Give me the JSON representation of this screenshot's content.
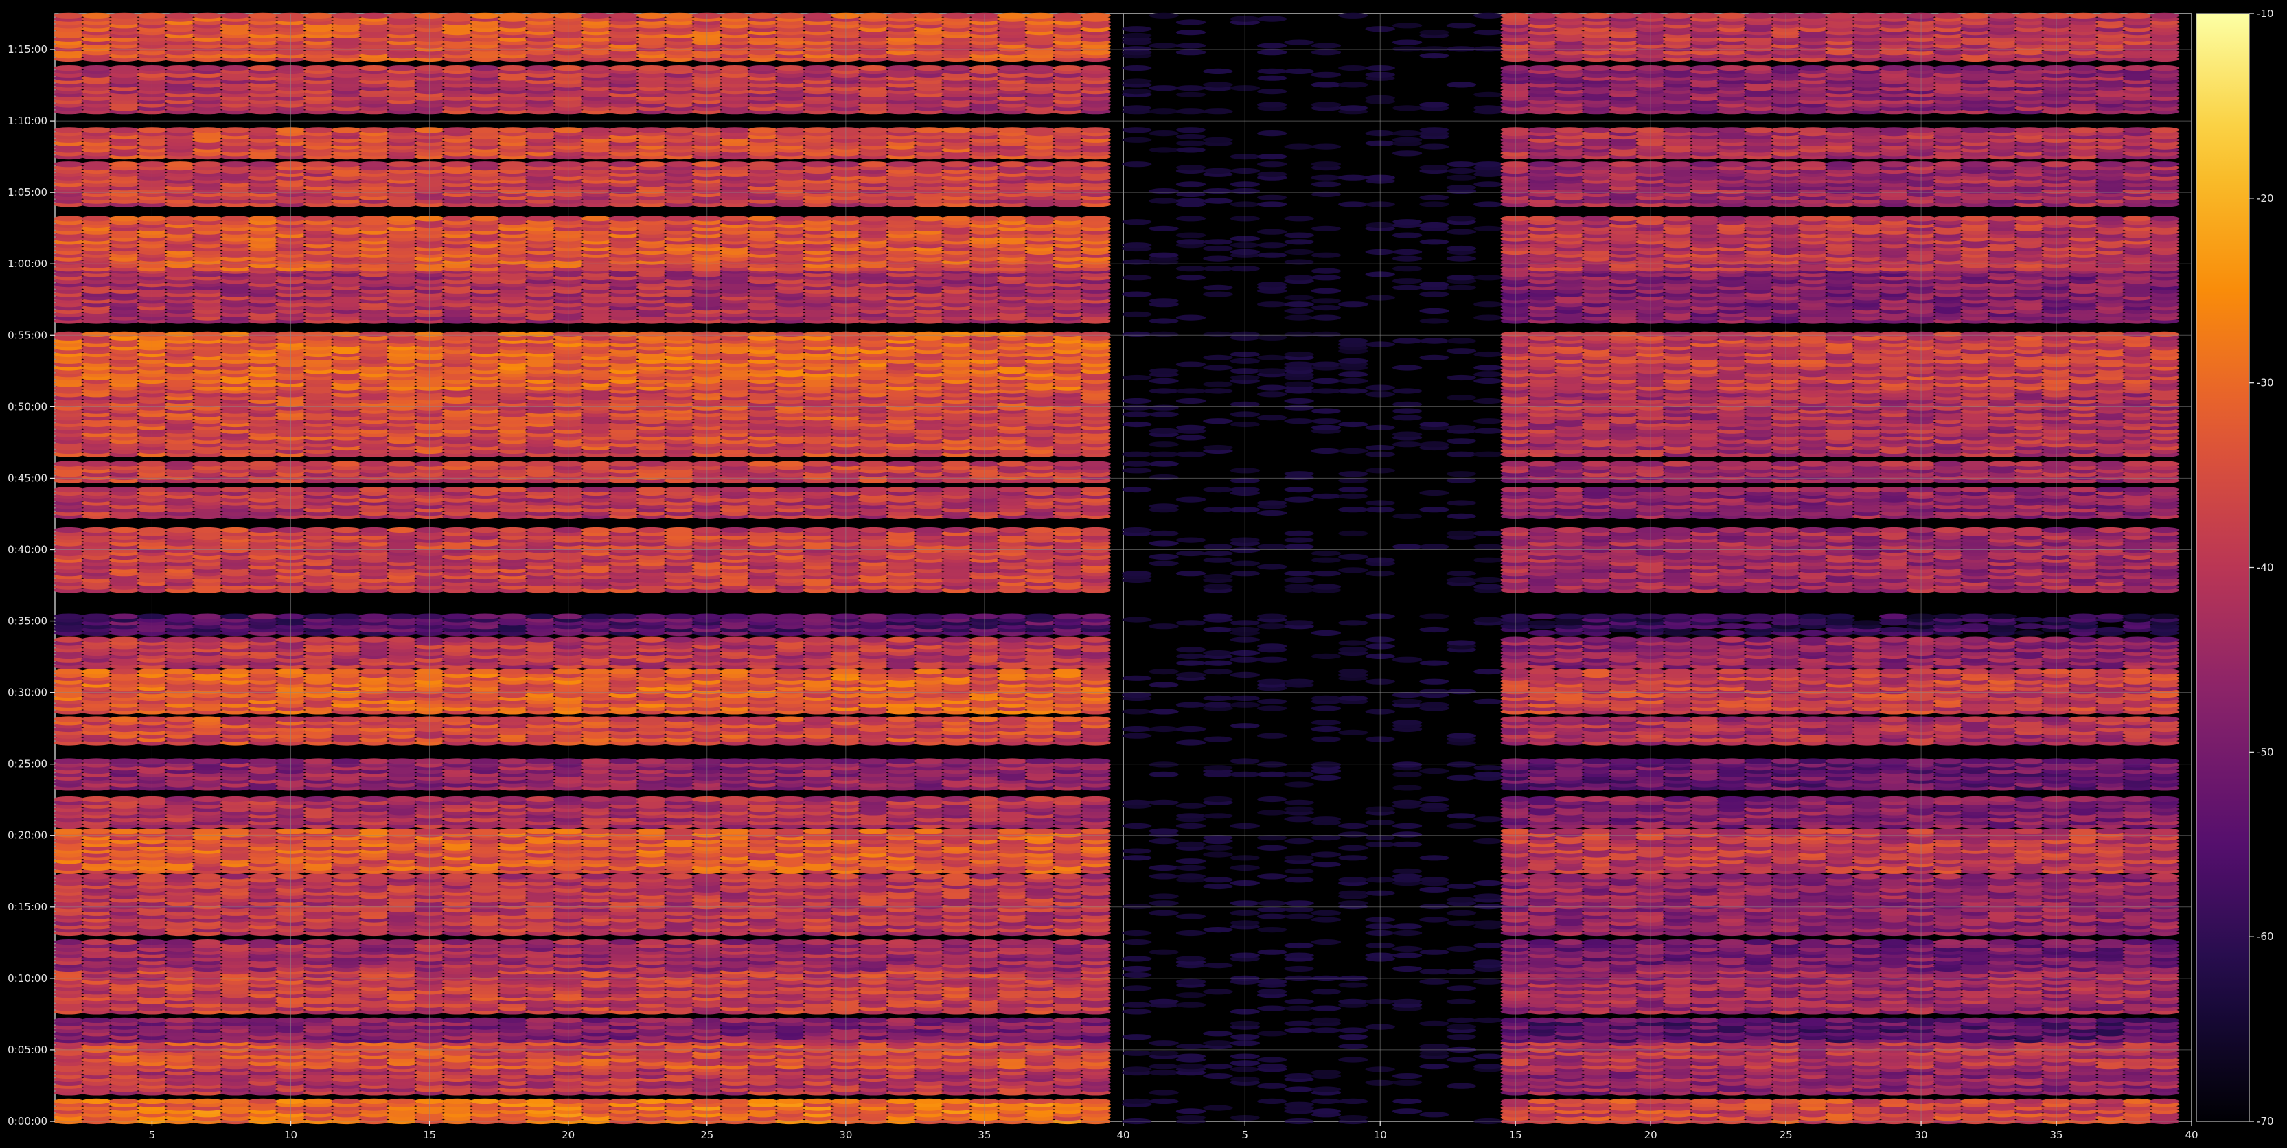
{
  "chart_data": {
    "type": "heatmap",
    "title": "",
    "xlabel": "",
    "ylabel": "",
    "render": "ellipse-cells",
    "colormap": "inferno",
    "grid": true,
    "background": "#000000",
    "gridColor": "#8a8a8a",
    "colorbar": {
      "placement": "right",
      "range": [
        -70,
        -10
      ],
      "ticks": [
        -10,
        -20,
        -30,
        -40,
        -50,
        -60,
        -70
      ]
    },
    "panels": [
      {
        "name": "left",
        "xlim": [
          1.5,
          40
        ],
        "xticks": [
          5,
          10,
          15,
          20,
          25,
          30,
          35,
          40
        ],
        "x_range": [
          2,
          39
        ],
        "ylim": [
          0,
          4650
        ],
        "active": true,
        "brighter": true
      },
      {
        "name": "right",
        "xlim": [
          0.5,
          40
        ],
        "xticks": [
          5,
          10,
          15,
          20,
          25,
          30,
          35,
          40
        ],
        "x_range": [
          1,
          39
        ],
        "ylim": [
          0,
          4650
        ],
        "active": true,
        "brighter": false,
        "dark_region": {
          "x_start": 1,
          "x_end": 14,
          "level": -62
        }
      }
    ],
    "yticks": [
      {
        "seconds": 0,
        "label": "0:00:00"
      },
      {
        "seconds": 300,
        "label": "0:05:00"
      },
      {
        "seconds": 600,
        "label": "0:10:00"
      },
      {
        "seconds": 900,
        "label": "0:15:00"
      },
      {
        "seconds": 1200,
        "label": "0:20:00"
      },
      {
        "seconds": 1500,
        "label": "0:25:00"
      },
      {
        "seconds": 1800,
        "label": "0:30:00"
      },
      {
        "seconds": 2100,
        "label": "0:35:00"
      },
      {
        "seconds": 2400,
        "label": "0:40:00"
      },
      {
        "seconds": 2700,
        "label": "0:45:00"
      },
      {
        "seconds": 3000,
        "label": "0:50:00"
      },
      {
        "seconds": 3300,
        "label": "0:55:00"
      },
      {
        "seconds": 3600,
        "label": "1:00:00"
      },
      {
        "seconds": 3900,
        "label": "1:05:00"
      },
      {
        "seconds": 4200,
        "label": "1:10:00"
      },
      {
        "seconds": 4500,
        "label": "1:15:00"
      }
    ],
    "row_blocks": [
      {
        "from": 0,
        "to": 95,
        "level": -30
      },
      {
        "from": 120,
        "to": 220,
        "level": -40
      },
      {
        "from": 230,
        "to": 330,
        "level": -35
      },
      {
        "from": 340,
        "to": 430,
        "level": -48
      },
      {
        "from": 460,
        "to": 640,
        "level": -38
      },
      {
        "from": 640,
        "to": 760,
        "level": -44
      },
      {
        "from": 790,
        "to": 1030,
        "level": -40
      },
      {
        "from": 1050,
        "to": 1220,
        "level": -33
      },
      {
        "from": 1240,
        "to": 1360,
        "level": -42
      },
      {
        "from": 1400,
        "to": 1520,
        "level": -46
      },
      {
        "from": 1590,
        "to": 1700,
        "level": -36
      },
      {
        "from": 1720,
        "to": 1900,
        "level": -32
      },
      {
        "from": 1910,
        "to": 2030,
        "level": -40
      },
      {
        "from": 2050,
        "to": 2130,
        "level": -55
      },
      {
        "from": 2230,
        "to": 2490,
        "level": -38
      },
      {
        "from": 2540,
        "to": 2660,
        "level": -40
      },
      {
        "from": 2690,
        "to": 2760,
        "level": -38
      },
      {
        "from": 2800,
        "to": 3070,
        "level": -36
      },
      {
        "from": 3080,
        "to": 3310,
        "level": -32
      },
      {
        "from": 3360,
        "to": 3570,
        "level": -42
      },
      {
        "from": 3580,
        "to": 3800,
        "level": -34
      },
      {
        "from": 3850,
        "to": 4030,
        "level": -38
      },
      {
        "from": 4050,
        "to": 4170,
        "level": -36
      },
      {
        "from": 4240,
        "to": 4430,
        "level": -40
      },
      {
        "from": 4460,
        "to": 4650,
        "level": -34
      }
    ]
  }
}
